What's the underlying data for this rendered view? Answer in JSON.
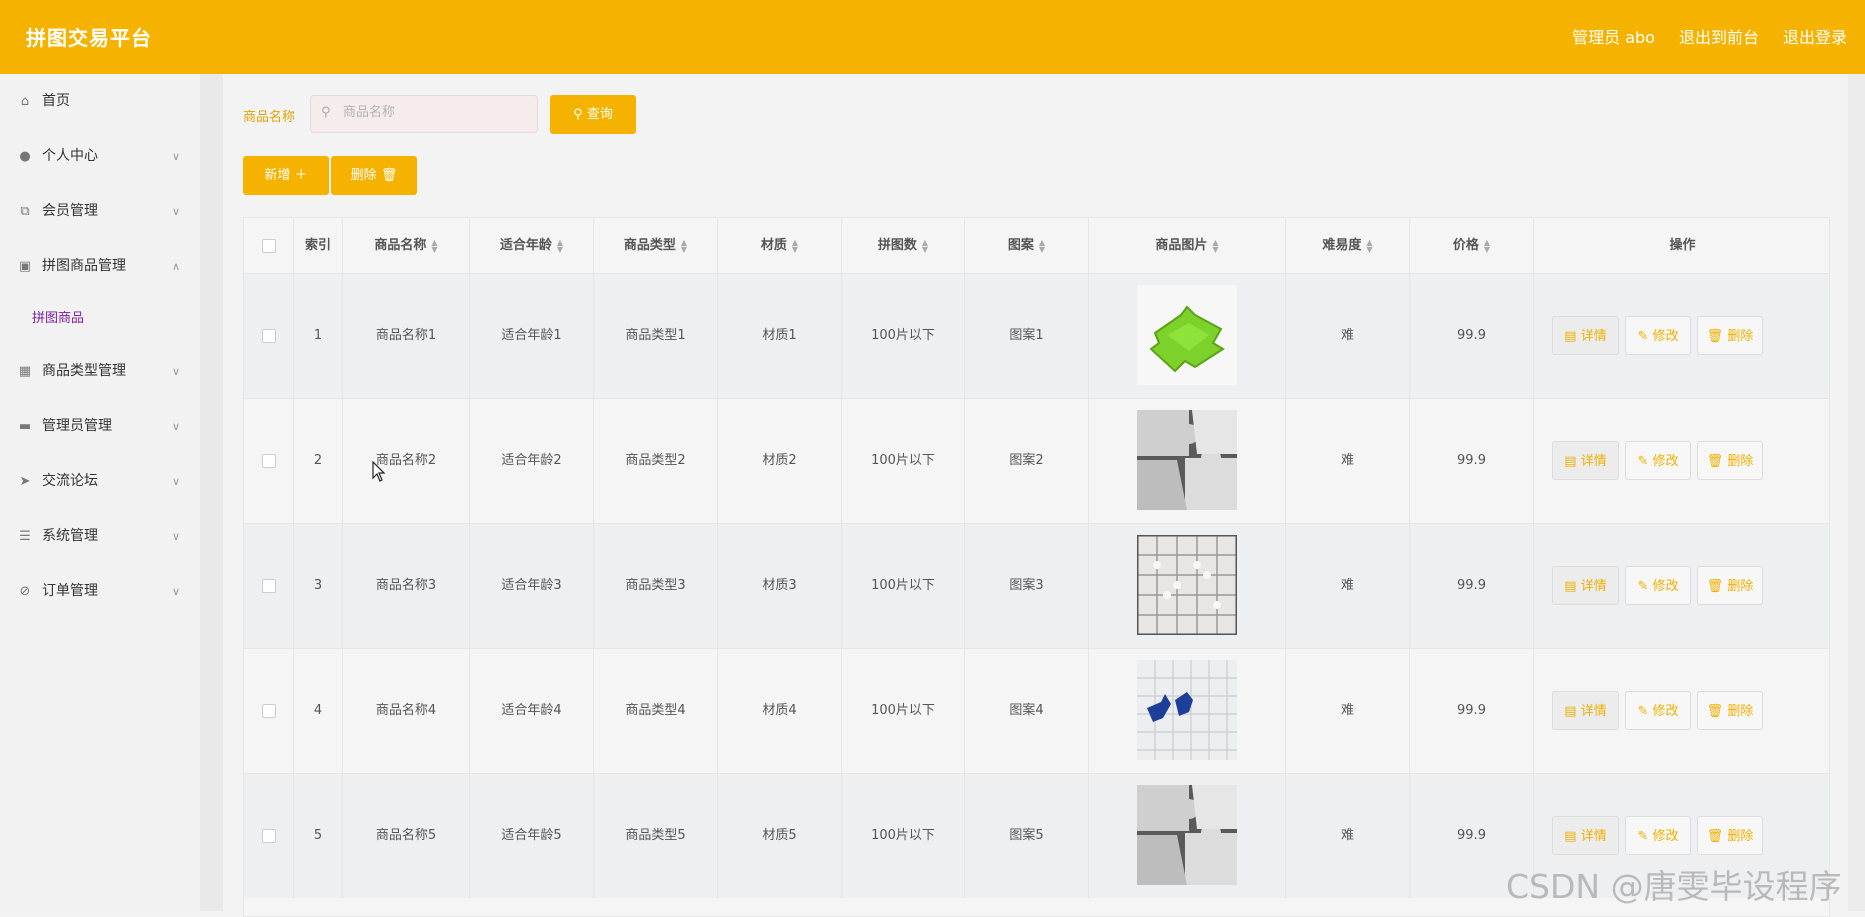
{
  "header": {
    "title": "拼图交易平台",
    "admin": "管理员 abo",
    "to_front": "退出到前台",
    "logout": "退出登录"
  },
  "sidebar": {
    "items": [
      {
        "label": "首页",
        "icon": "home-icon"
      },
      {
        "label": "个人中心",
        "icon": "user-icon"
      },
      {
        "label": "会员管理",
        "icon": "copy-icon"
      },
      {
        "label": "拼图商品管理",
        "icon": "briefcase-icon"
      },
      {
        "label": "商品类型管理",
        "icon": "clipboard-icon"
      },
      {
        "label": "管理员管理",
        "icon": "monitor-icon"
      },
      {
        "label": "交流论坛",
        "icon": "send-icon"
      },
      {
        "label": "系统管理",
        "icon": "menu-icon"
      },
      {
        "label": "订单管理",
        "icon": "no-bell-icon"
      }
    ],
    "sub_item": "拼图商品"
  },
  "search": {
    "label": "商品名称",
    "placeholder": "商品名称",
    "button": "查询"
  },
  "toolbar": {
    "add": "新增",
    "delete": "删除"
  },
  "table": {
    "headers": [
      "索引",
      "商品名称",
      "适合年龄",
      "商品类型",
      "材质",
      "拼图数",
      "图案",
      "商品图片",
      "难易度",
      "价格",
      "操作"
    ],
    "rows": [
      {
        "index": "1",
        "name": "商品名称1",
        "age": "适合年龄1",
        "type": "商品类型1",
        "material": "材质1",
        "pieces": "100片以下",
        "pattern": "图案1",
        "difficulty": "难",
        "price": "99.9",
        "image": "green-puzzle"
      },
      {
        "index": "2",
        "name": "商品名称2",
        "age": "适合年龄2",
        "type": "商品类型2",
        "material": "材质2",
        "pieces": "100片以下",
        "pattern": "图案2",
        "difficulty": "难",
        "price": "99.9",
        "image": "grey-puzzle"
      },
      {
        "index": "3",
        "name": "商品名称3",
        "age": "适合年龄3",
        "type": "商品类型3",
        "material": "材质3",
        "pieces": "100片以下",
        "pattern": "图案3",
        "difficulty": "难",
        "price": "99.9",
        "image": "white-puzzle-grid"
      },
      {
        "index": "4",
        "name": "商品名称4",
        "age": "适合年龄4",
        "type": "商品类型4",
        "material": "材质4",
        "pieces": "100片以下",
        "pattern": "图案4",
        "difficulty": "难",
        "price": "99.9",
        "image": "blue-white-puzzle"
      },
      {
        "index": "5",
        "name": "商品名称5",
        "age": "适合年龄5",
        "type": "商品类型5",
        "material": "材质5",
        "pieces": "100片以下",
        "pattern": "图案5",
        "difficulty": "难",
        "price": "99.9",
        "image": "grey-puzzle"
      }
    ],
    "actions": {
      "detail": "详情",
      "edit": "修改",
      "delete": "删除"
    }
  },
  "watermark": "CSDN @唐雯毕设程序",
  "colors": {
    "accent": "#f5b300",
    "sub_item": "#7a1fa2"
  }
}
